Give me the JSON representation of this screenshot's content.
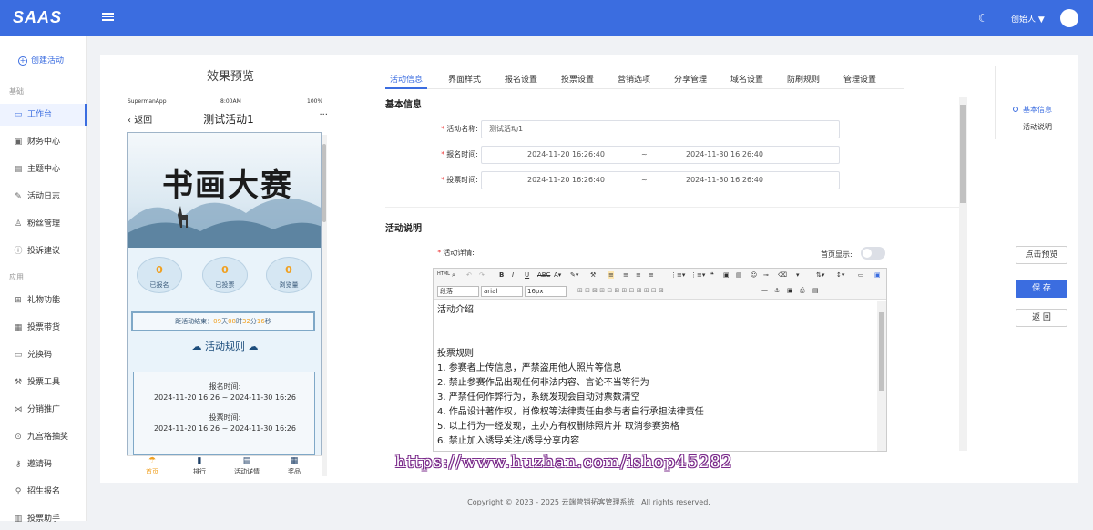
{
  "header": {
    "logo": "SAAS",
    "user": "创始人 ▼"
  },
  "sidebar": {
    "create": "创建活动",
    "section_basic": "基础",
    "section_app": "应用",
    "items": [
      {
        "label": "工作台",
        "icon": "monitor-icon",
        "glyph": "▭"
      },
      {
        "label": "财务中心",
        "icon": "wallet-icon",
        "glyph": "▣"
      },
      {
        "label": "主题中心",
        "icon": "theme-icon",
        "glyph": "▤"
      },
      {
        "label": "活动日志",
        "icon": "edit-icon",
        "glyph": "✎"
      },
      {
        "label": "粉丝管理",
        "icon": "user-icon",
        "glyph": "♙"
      },
      {
        "label": "投诉建议",
        "icon": "info-icon",
        "glyph": "ⓘ"
      },
      {
        "label": "礼物功能",
        "icon": "gift-icon",
        "glyph": "⊞"
      },
      {
        "label": "投票带货",
        "icon": "cart-icon",
        "glyph": "▦"
      },
      {
        "label": "兑换码",
        "icon": "code-icon",
        "glyph": "▭"
      },
      {
        "label": "投票工具",
        "icon": "tool-icon",
        "glyph": "⚒"
      },
      {
        "label": "分销推广",
        "icon": "share-icon",
        "glyph": "⋈"
      },
      {
        "label": "九宫格抽奖",
        "icon": "grid-icon",
        "glyph": "⊙"
      },
      {
        "label": "邀请码",
        "icon": "key-icon",
        "glyph": "⚷"
      },
      {
        "label": "招生报名",
        "icon": "enroll-icon",
        "glyph": "⚲"
      },
      {
        "label": "投票助手",
        "icon": "helper-icon",
        "glyph": "▥"
      }
    ]
  },
  "preview": {
    "title": "效果预览",
    "status_carrier": "SupermanApp",
    "status_time": "8:00AM",
    "status_battery": "100%",
    "back": "返回",
    "page_title": "测试活动1",
    "more": "···",
    "banner_title": "书画大赛",
    "stats": [
      {
        "num": "0",
        "label": "已报名"
      },
      {
        "num": "0",
        "label": "已投票"
      },
      {
        "num": "0",
        "label": "浏览量"
      }
    ],
    "countdown": {
      "prefix": "距活动结束：",
      "d": "09",
      "d_unit": "天",
      "h": "08",
      "h_unit": "时",
      "m": "32",
      "m_unit": "分",
      "s": "16",
      "s_unit": "秒"
    },
    "rules_title": "活动规则",
    "reg_label": "报名时间:",
    "reg_value": "2024-11-20 16:26 ~ 2024-11-30 16:26",
    "vote_label": "投票时间:",
    "vote_value": "2024-11-20 16:26 ~ 2024-11-30 16:26",
    "tabbar": [
      "首页",
      "排行",
      "活动详情",
      "奖品"
    ]
  },
  "tabs": [
    "活动信息",
    "界面样式",
    "报名设置",
    "投票设置",
    "营销选项",
    "分享管理",
    "域名设置",
    "防刷规则",
    "管理设置"
  ],
  "form": {
    "basic_heading": "基本信息",
    "name_label": "活动名称:",
    "name_value": "测试活动1",
    "reg_label": "报名时间:",
    "reg_start": "2024-11-20 16:26:40",
    "reg_end": "2024-11-30 16:26:40",
    "vote_label": "投票时间:",
    "vote_start": "2024-11-20 16:26:40",
    "vote_end": "2024-11-30 16:26:40",
    "range_sep": "~",
    "desc_heading": "活动说明",
    "detail_label": "活动详情:",
    "home_show_label": "首页显示:",
    "home_show": false
  },
  "editor": {
    "para_select": "段落",
    "font_select": "arial",
    "size_select": "16px",
    "lines": [
      "活动介绍",
      "",
      "",
      "投票规则",
      "1.    参赛者上传信息，严禁盗用他人照片等信息",
      "2.    禁止参赛作品出现任何非法内容、言论不当等行为",
      "3.    严禁任何作弊行为，系统发现会自动对票数清空",
      "4.    作品设计著作权，肖像权等法律责任由参与者自行承担法律责任",
      "5.    以上行为一经发现，主办方有权删除照片并 取消参赛资格",
      "6.    禁止加入诱导关注/诱导分享内容"
    ]
  },
  "anchors": [
    "基本信息",
    "活动说明"
  ],
  "buttons": {
    "preview": "点击预览",
    "save": "保 存",
    "back": "返 回"
  },
  "watermark": "https://www.huzhan.com/ishop45282",
  "footer": "Copyright © 2023 - 2025 云端营销拓客管理系统 . All rights reserved.",
  "colors": {
    "brand": "#3b6de0",
    "accent": "#f0a020"
  }
}
